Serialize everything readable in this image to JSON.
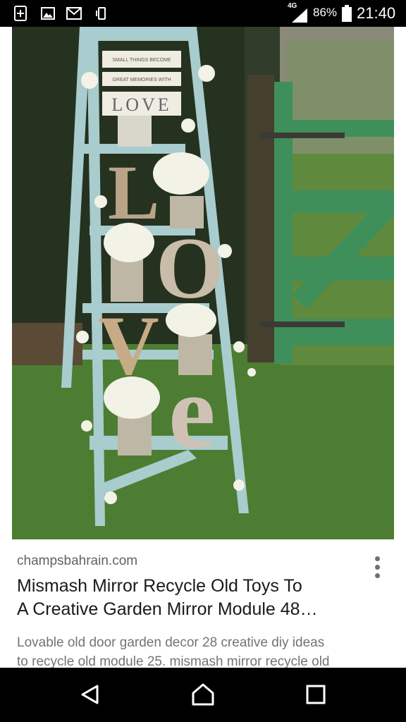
{
  "status_bar": {
    "network": "4G",
    "battery": "86%",
    "time": "21:40",
    "left_icons": [
      "add-box-icon",
      "image-icon",
      "mail-icon",
      "phone-vibrate-icon"
    ]
  },
  "result": {
    "image_icon": "photo",
    "source": "champsbahrain.com",
    "title_lines": [
      "Mismash Mirror Recycle Old Toys To",
      "A Creative Garden Mirror Module 48…"
    ],
    "description_lines": [
      "Lovable old door garden decor 28 creative diy ideas",
      "to recycle old module 25. mismash mirror recycle old"
    ],
    "sign_text": [
      "SMALL THINGS BECOME",
      "GREAT MEMORIES WITH",
      "LOVE"
    ],
    "image_letters": [
      "L",
      "O",
      "V",
      "e"
    ]
  },
  "nav_bar": {
    "buttons": [
      "back-icon",
      "home-icon",
      "recents-icon"
    ]
  }
}
